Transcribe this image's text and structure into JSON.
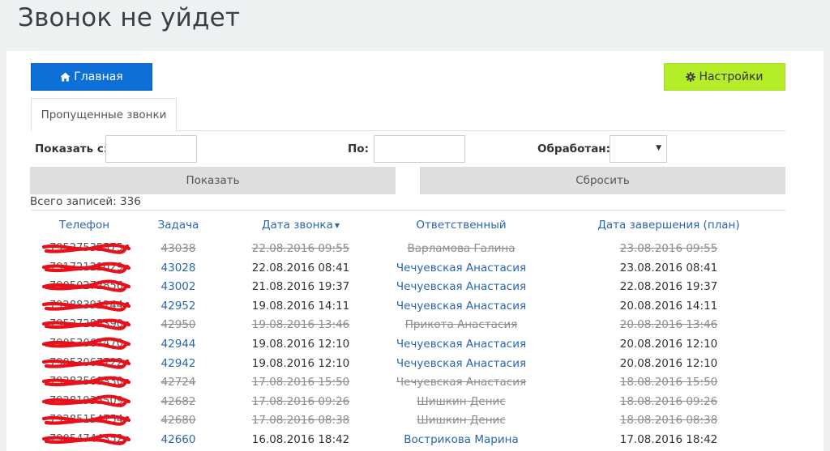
{
  "page_title": "Звонок не уйдет",
  "nav": {
    "home_label": "Главная",
    "settings_label": "Настройки"
  },
  "tabs": [
    {
      "label": "Пропущенные звонки",
      "active": true
    }
  ],
  "filters": {
    "from_label": "Показать с:",
    "from_value": "",
    "to_label": "По:",
    "to_value": "",
    "processed_label": "Обработан:",
    "processed_value": "",
    "show_label": "Показать",
    "reset_label": "Сбросить"
  },
  "total_label": "Всего записей: 336",
  "table": {
    "columns": [
      "Телефон",
      "Задача",
      "Дата звонка",
      "Ответственный",
      "Дата завершения (план)"
    ],
    "sort_column": "Дата звонка",
    "rows": [
      {
        "phone": "79527535575",
        "task": "43038",
        "call_date": "22.08.2016 09:55",
        "responsible": "Варламова Галина",
        "due_date": "23.08.2016 09:55",
        "done": true
      },
      {
        "phone": "79172121029",
        "task": "43028",
        "call_date": "22.08.2016 08:41",
        "responsible": "Чечуевская Анастасия",
        "due_date": "23.08.2016 08:41",
        "done": false
      },
      {
        "phone": "79050272856",
        "task": "43002",
        "call_date": "21.08.2016 19:37",
        "responsible": "Чечуевская Анастасия",
        "due_date": "22.08.2016 19:37",
        "done": false
      },
      {
        "phone": "79288391244",
        "task": "42952",
        "call_date": "19.08.2016 14:11",
        "responsible": "Чечуевская Анастасия",
        "due_date": "20.08.2016 14:11",
        "done": false
      },
      {
        "phone": "79527285390",
        "task": "42950",
        "call_date": "19.08.2016 13:46",
        "responsible": "Прикота Анастасия",
        "due_date": "20.08.2016 13:46",
        "done": true
      },
      {
        "phone": "79053067470",
        "task": "42944",
        "call_date": "19.08.2016 12:10",
        "responsible": "Чечуевская Анастасия",
        "due_date": "20.08.2016 12:10",
        "done": false
      },
      {
        "phone": "79053067722",
        "task": "42942",
        "call_date": "19.08.2016 12:10",
        "responsible": "Чечуевская Анастасия",
        "due_date": "20.08.2016 12:10",
        "done": false
      },
      {
        "phone": "79283560330",
        "task": "42724",
        "call_date": "17.08.2016 15:50",
        "responsible": "Чечуевская Анастасия",
        "due_date": "18.08.2016 15:50",
        "done": true
      },
      {
        "phone": "79281935509",
        "task": "42682",
        "call_date": "17.08.2016 09:26",
        "responsible": "Шишкин Денис",
        "due_date": "18.08.2016 09:26",
        "done": true
      },
      {
        "phone": "79285154754",
        "task": "42680",
        "call_date": "17.08.2016 08:38",
        "responsible": "Шишкин Денис",
        "due_date": "18.08.2016 08:38",
        "done": true
      },
      {
        "phone": "79054744352",
        "task": "42660",
        "call_date": "16.08.2016 18:42",
        "responsible": "Вострикова Марина",
        "due_date": "17.08.2016 18:42",
        "done": false
      }
    ]
  },
  "colors": {
    "primary_button": "#0d6fd8",
    "settings_button": "#b5ee28",
    "link": "#2a66b0",
    "redaction": "#e8111b"
  }
}
